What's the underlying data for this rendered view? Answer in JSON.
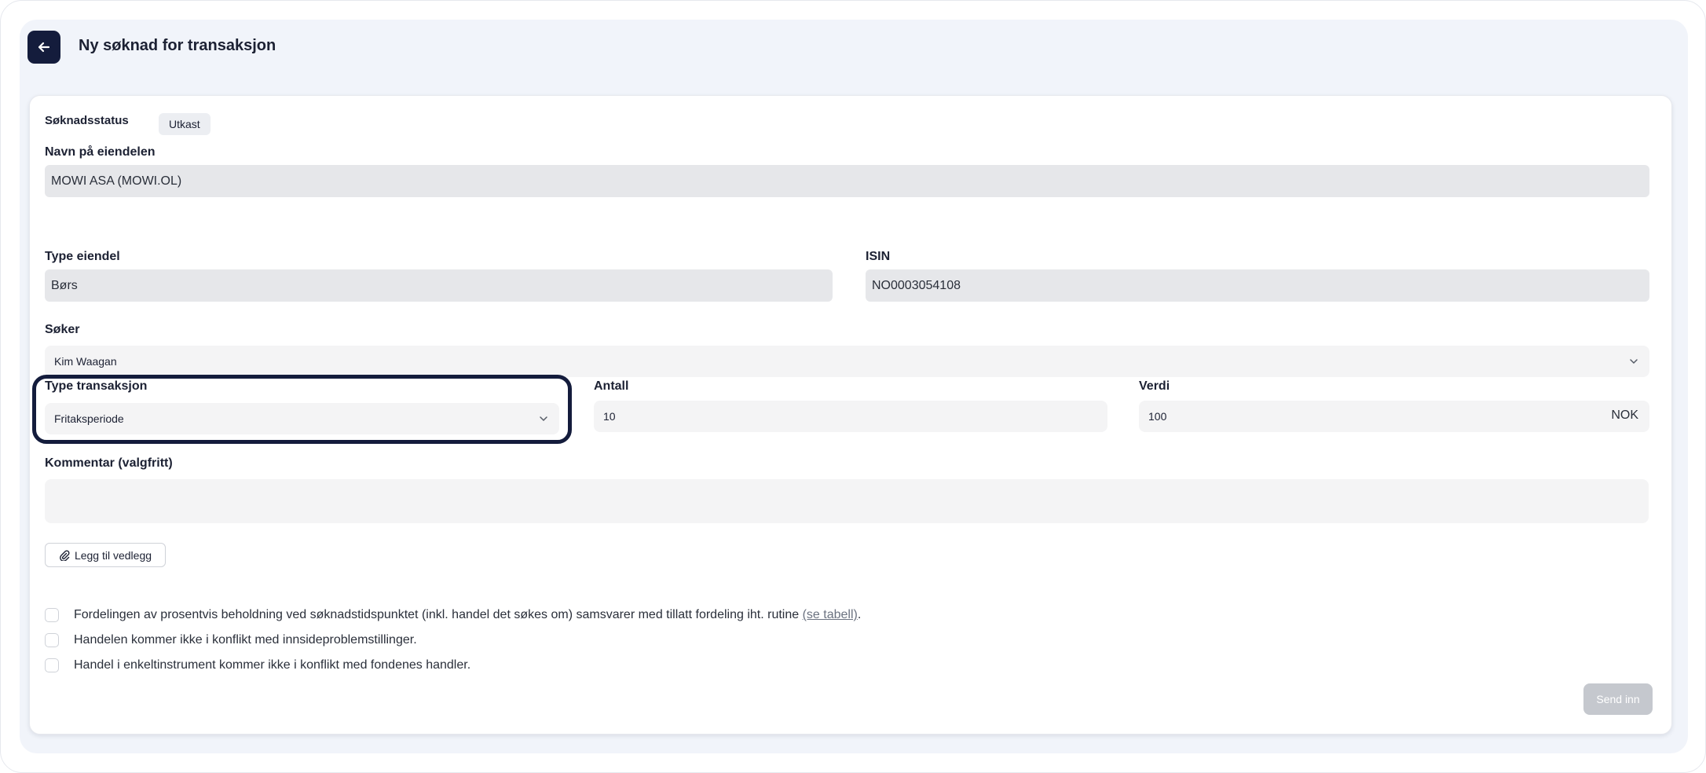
{
  "header": {
    "title": "Ny søknad for transaksjon"
  },
  "status": {
    "label": "Søknadsstatus",
    "value": "Utkast"
  },
  "asset_name": {
    "label": "Navn på eiendelen",
    "value": "MOWI ASA (MOWI.OL)"
  },
  "asset_type": {
    "label": "Type eiendel",
    "value": "Børs"
  },
  "isin": {
    "label": "ISIN",
    "value": "NO0003054108"
  },
  "applicant": {
    "label": "Søker",
    "value": "Kim Waagan"
  },
  "transaction_type": {
    "label": "Type transaksjon",
    "value": "Fritaksperiode"
  },
  "quantity": {
    "label": "Antall",
    "value": "10"
  },
  "amount": {
    "label": "Verdi",
    "value": "100",
    "unit": "NOK"
  },
  "comment": {
    "label": "Kommentar (valgfritt)",
    "value": ""
  },
  "attach": {
    "label": "Legg til vedlegg"
  },
  "checks": [
    {
      "text": "Fordelingen av prosentvis beholdning ved søknadstidspunktet (inkl. handel det søkes om) samsvarer med tillatt fordeling iht. rutine ",
      "link": "(se tabell)",
      "suffix": "."
    },
    {
      "text": "Handelen kommer ikke i konflikt med innsideproblemstillinger."
    },
    {
      "text": "Handel i enkeltinstrument kommer ikke i konflikt med fondenes handler."
    }
  ],
  "submit": {
    "label": "Send inn"
  },
  "colors": {
    "accent": "#141c3c",
    "disabled_button": "#c5c8ce",
    "readonly_field": "#e6e7ea"
  }
}
